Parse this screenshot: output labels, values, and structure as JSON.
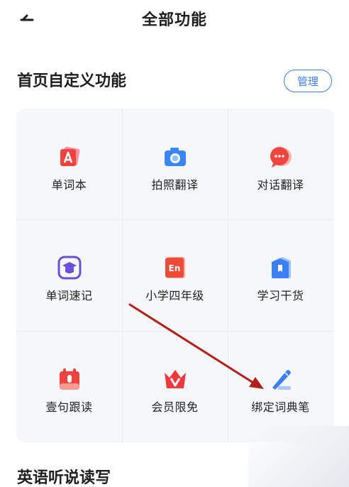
{
  "header": {
    "title": "全部功能"
  },
  "custom_section": {
    "title": "首页自定义功能",
    "manage_label": "管理"
  },
  "features": [
    {
      "label": "单词本",
      "icon": "wordbook-icon"
    },
    {
      "label": "拍照翻译",
      "icon": "camera-icon"
    },
    {
      "label": "对话翻译",
      "icon": "chat-bubble-icon"
    },
    {
      "label": "单词速记",
      "icon": "graduation-cap-icon"
    },
    {
      "label": "小学四年级",
      "icon": "en-book-icon"
    },
    {
      "label": "学习干货",
      "icon": "bookmark-badge-icon"
    },
    {
      "label": "壹句跟读",
      "icon": "mic-calendar-icon"
    },
    {
      "label": "会员限免",
      "icon": "crown-v-icon"
    },
    {
      "label": "绑定词典笔",
      "icon": "pen-icon"
    }
  ],
  "next_section": {
    "title": "英语听说读写"
  },
  "colors": {
    "accent": "#3e7bf2",
    "annotation_arrow": "#b3201c"
  }
}
